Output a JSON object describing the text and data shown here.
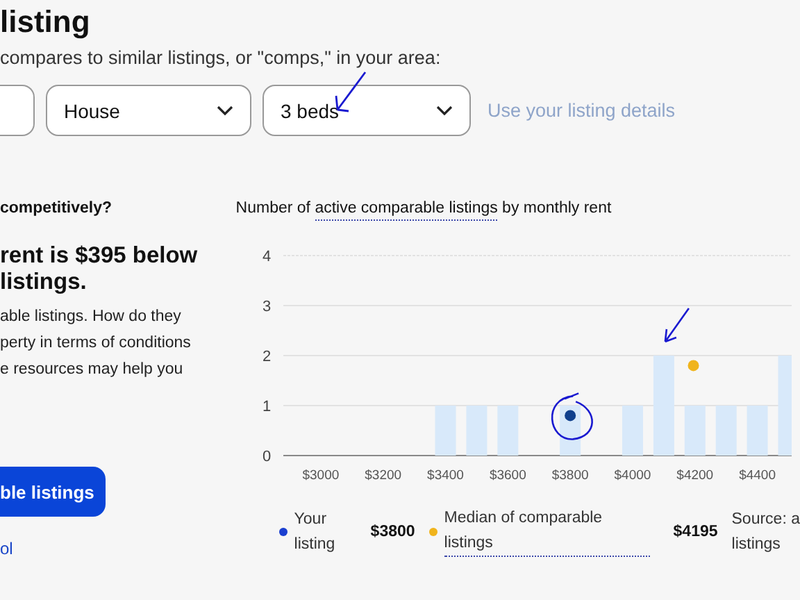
{
  "title": "listing",
  "subtitle": "compares to similar listings, or \"comps,\" in your area:",
  "filters": [
    {
      "value": "House"
    },
    {
      "value": "3 beds"
    }
  ],
  "details_link": "Use your listing details",
  "question": "competitively?",
  "headline_lines": [
    "rent is $395 below",
    "listings."
  ],
  "body_lines": [
    "able listings. How do they",
    "perty in terms of conditions",
    "e resources may help you"
  ],
  "primary_button": "ble listings",
  "bottom_link": "ol",
  "chart_title": {
    "before": "Number of ",
    "link": "active comparable listings",
    "after": " by monthly rent"
  },
  "chart_data": {
    "type": "bar",
    "grid": true,
    "xlim": [
      2880,
      4510
    ],
    "x": [
      3400,
      3500,
      3600,
      3800,
      4000,
      4100,
      4200,
      4300,
      4400,
      4500
    ],
    "values": [
      1,
      1,
      1,
      1,
      1,
      2,
      1,
      1,
      1,
      2
    ],
    "ylim": [
      0,
      4
    ],
    "yticks": [
      0,
      1,
      2,
      3,
      4
    ],
    "xticks": [
      {
        "value": 3000,
        "label": "$3000"
      },
      {
        "value": 3200,
        "label": "$3200"
      },
      {
        "value": 3400,
        "label": "$3400"
      },
      {
        "value": 3600,
        "label": "$3600"
      },
      {
        "value": 3800,
        "label": "$3800"
      },
      {
        "value": 4000,
        "label": "$4000"
      },
      {
        "value": 4200,
        "label": "$4200"
      },
      {
        "value": 4400,
        "label": "$4400"
      }
    ]
  },
  "legend": [
    {
      "label": "Your listing",
      "value": "$3800",
      "color": "#1a3fd0",
      "dotted": false
    },
    {
      "label": "Median of comparable listings",
      "value": "$4195",
      "color": "#f0b41c",
      "dotted": true
    }
  ],
  "source_lines": [
    "Source: a",
    "listings"
  ]
}
